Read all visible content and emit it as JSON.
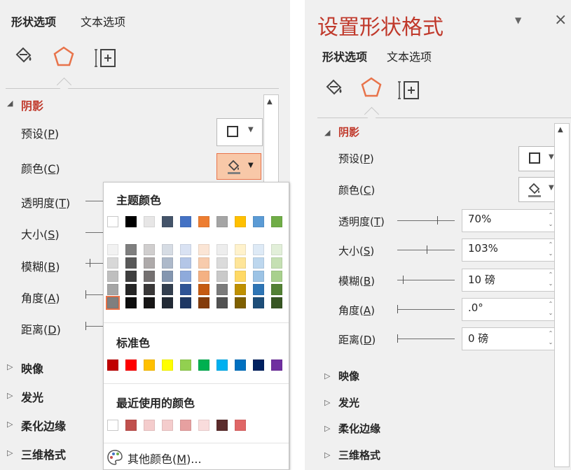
{
  "left": {
    "tabs": [
      "形状选项",
      "文本选项"
    ],
    "shadow_heading": "阴影",
    "rows": [
      {
        "text": "预设(",
        "key": "P",
        "end": ")"
      },
      {
        "text": "颜色(",
        "key": "C",
        "end": ")"
      },
      {
        "text": "透明度(",
        "key": "T",
        "end": ")"
      },
      {
        "text": "大小(",
        "key": "S",
        "end": ")"
      },
      {
        "text": "模糊(",
        "key": "B",
        "end": ")"
      },
      {
        "text": "角度(",
        "key": "A",
        "end": ")"
      },
      {
        "text": "距离(",
        "key": "D",
        "end": ")"
      }
    ],
    "collapsed_sections": [
      "映像",
      "发光",
      "柔化边缘",
      "三维格式"
    ]
  },
  "popup": {
    "theme_title": "主题颜色",
    "standard_title": "标准色",
    "recent_title": "最近使用的颜色",
    "more_colors_text": "其他颜色(",
    "more_colors_key": "M",
    "more_colors_end": ")...",
    "theme_top": [
      "#ffffff",
      "#000000",
      "#e7e6e6",
      "#44546a",
      "#4472c4",
      "#ed7d31",
      "#a5a5a5",
      "#ffc000",
      "#5b9bd5",
      "#70ad47"
    ],
    "theme_shades": [
      [
        "#f2f2f2",
        "#d8d8d8",
        "#bfbfbf",
        "#a5a5a5",
        "#7f7f7f"
      ],
      [
        "#7f7f7f",
        "#595959",
        "#3f3f3f",
        "#262626",
        "#0d0d0d"
      ],
      [
        "#d0cece",
        "#aeaaaa",
        "#757171",
        "#3a3838",
        "#171616"
      ],
      [
        "#d6dce4",
        "#adb9ca",
        "#8496b0",
        "#333f4f",
        "#222a35"
      ],
      [
        "#d9e2f3",
        "#b4c6e7",
        "#8eaadb",
        "#2f5496",
        "#1f3864"
      ],
      [
        "#fbe5d5",
        "#f7cbac",
        "#f4b183",
        "#c55a11",
        "#843c0b"
      ],
      [
        "#ededed",
        "#dbdbdb",
        "#c9c9c9",
        "#7b7b7b",
        "#525252"
      ],
      [
        "#fff2cc",
        "#fee599",
        "#ffd965",
        "#bf9000",
        "#7f6000"
      ],
      [
        "#deeaf6",
        "#bdd7ee",
        "#9cc3e5",
        "#2e75b5",
        "#1e4e79"
      ],
      [
        "#e2efd9",
        "#c5e0b3",
        "#a8d08d",
        "#538135",
        "#375623"
      ]
    ],
    "standard": [
      "#c00000",
      "#ff0000",
      "#ffc000",
      "#ffff00",
      "#92d050",
      "#00b050",
      "#00b0f0",
      "#0070c0",
      "#002060",
      "#7030a0"
    ],
    "recent": [
      "#ffffff",
      "#c0504d",
      "#f4cccc",
      "#f4cccc",
      "#e6a0a0",
      "#f9dcdc",
      "#5b2c2c",
      "#e06666"
    ]
  },
  "right": {
    "title": "设置形状格式",
    "tabs": [
      "形状选项",
      "文本选项"
    ],
    "shadow_heading": "阴影",
    "rows": [
      {
        "text": "预设(",
        "key": "P",
        "end": ")"
      },
      {
        "text": "颜色(",
        "key": "C",
        "end": ")"
      },
      {
        "text": "透明度(",
        "key": "T",
        "end": ")",
        "value": "70%"
      },
      {
        "text": "大小(",
        "key": "S",
        "end": ")",
        "value": "103%"
      },
      {
        "text": "模糊(",
        "key": "B",
        "end": ")",
        "value": "10 磅"
      },
      {
        "text": "角度(",
        "key": "A",
        "end": ")",
        "value": ".0°"
      },
      {
        "text": "距离(",
        "key": "D",
        "end": ")",
        "value": "0 磅"
      }
    ],
    "collapsed_sections": [
      "映像",
      "发光",
      "柔化边缘",
      "三维格式"
    ],
    "sliders": {
      "transparency": 0.7,
      "size": 0.515,
      "blur": 0.1,
      "angle": 0.0,
      "distance": 0.0
    }
  },
  "icons": {
    "fill": "paint-bucket-icon",
    "effects": "pentagon-icon",
    "layout": "size-properties-icon"
  },
  "accent": "#c0392b",
  "icon_accent": "#e8734a"
}
